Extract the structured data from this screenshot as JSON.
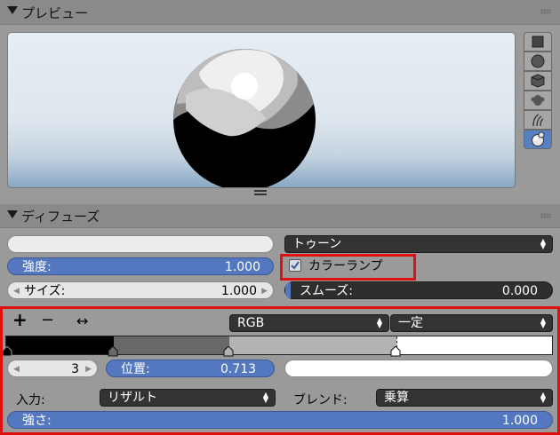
{
  "preview_panel": {
    "title": "プレビュー",
    "shape_buttons": [
      {
        "icon": "plane-icon"
      },
      {
        "icon": "sphere-icon"
      },
      {
        "icon": "cube-icon"
      },
      {
        "icon": "monkey-icon"
      },
      {
        "icon": "hair-icon"
      },
      {
        "icon": "sphere-sky-icon",
        "active": true
      }
    ]
  },
  "diffuse_panel": {
    "title": "ディフューズ",
    "shader_menu": "トゥーン",
    "intensity": {
      "label": "強度:",
      "value": "1.000"
    },
    "size": {
      "label": "サイズ:",
      "value": "1.000"
    },
    "ramp_checkbox": {
      "label": "カラーランプ",
      "checked": true
    },
    "smooth": {
      "label": "スムーズ:",
      "value": "0.000"
    }
  },
  "color_ramp": {
    "add_symbol": "+",
    "remove_symbol": "−",
    "flip_symbol": "↔",
    "color_mode": "RGB",
    "interpolation": "一定",
    "stops": [
      {
        "pos": 0.0,
        "color": "#000000"
      },
      {
        "pos": 0.196,
        "color": "#686868"
      },
      {
        "pos": 0.41,
        "color": "#b3b3b3"
      },
      {
        "pos": 0.713,
        "color": "#ffffff"
      }
    ],
    "active_index": "3",
    "position": {
      "label": "位置:",
      "value": "0.713"
    },
    "input": {
      "label": "入力:",
      "value": "リザルト"
    },
    "blend": {
      "label": "ブレンド:",
      "value": "乗算"
    },
    "factor": {
      "label": "強さ:",
      "value": "1.000"
    }
  },
  "colors": {
    "accent_blue": "#5478bf",
    "highlight_red": "#e01010"
  }
}
